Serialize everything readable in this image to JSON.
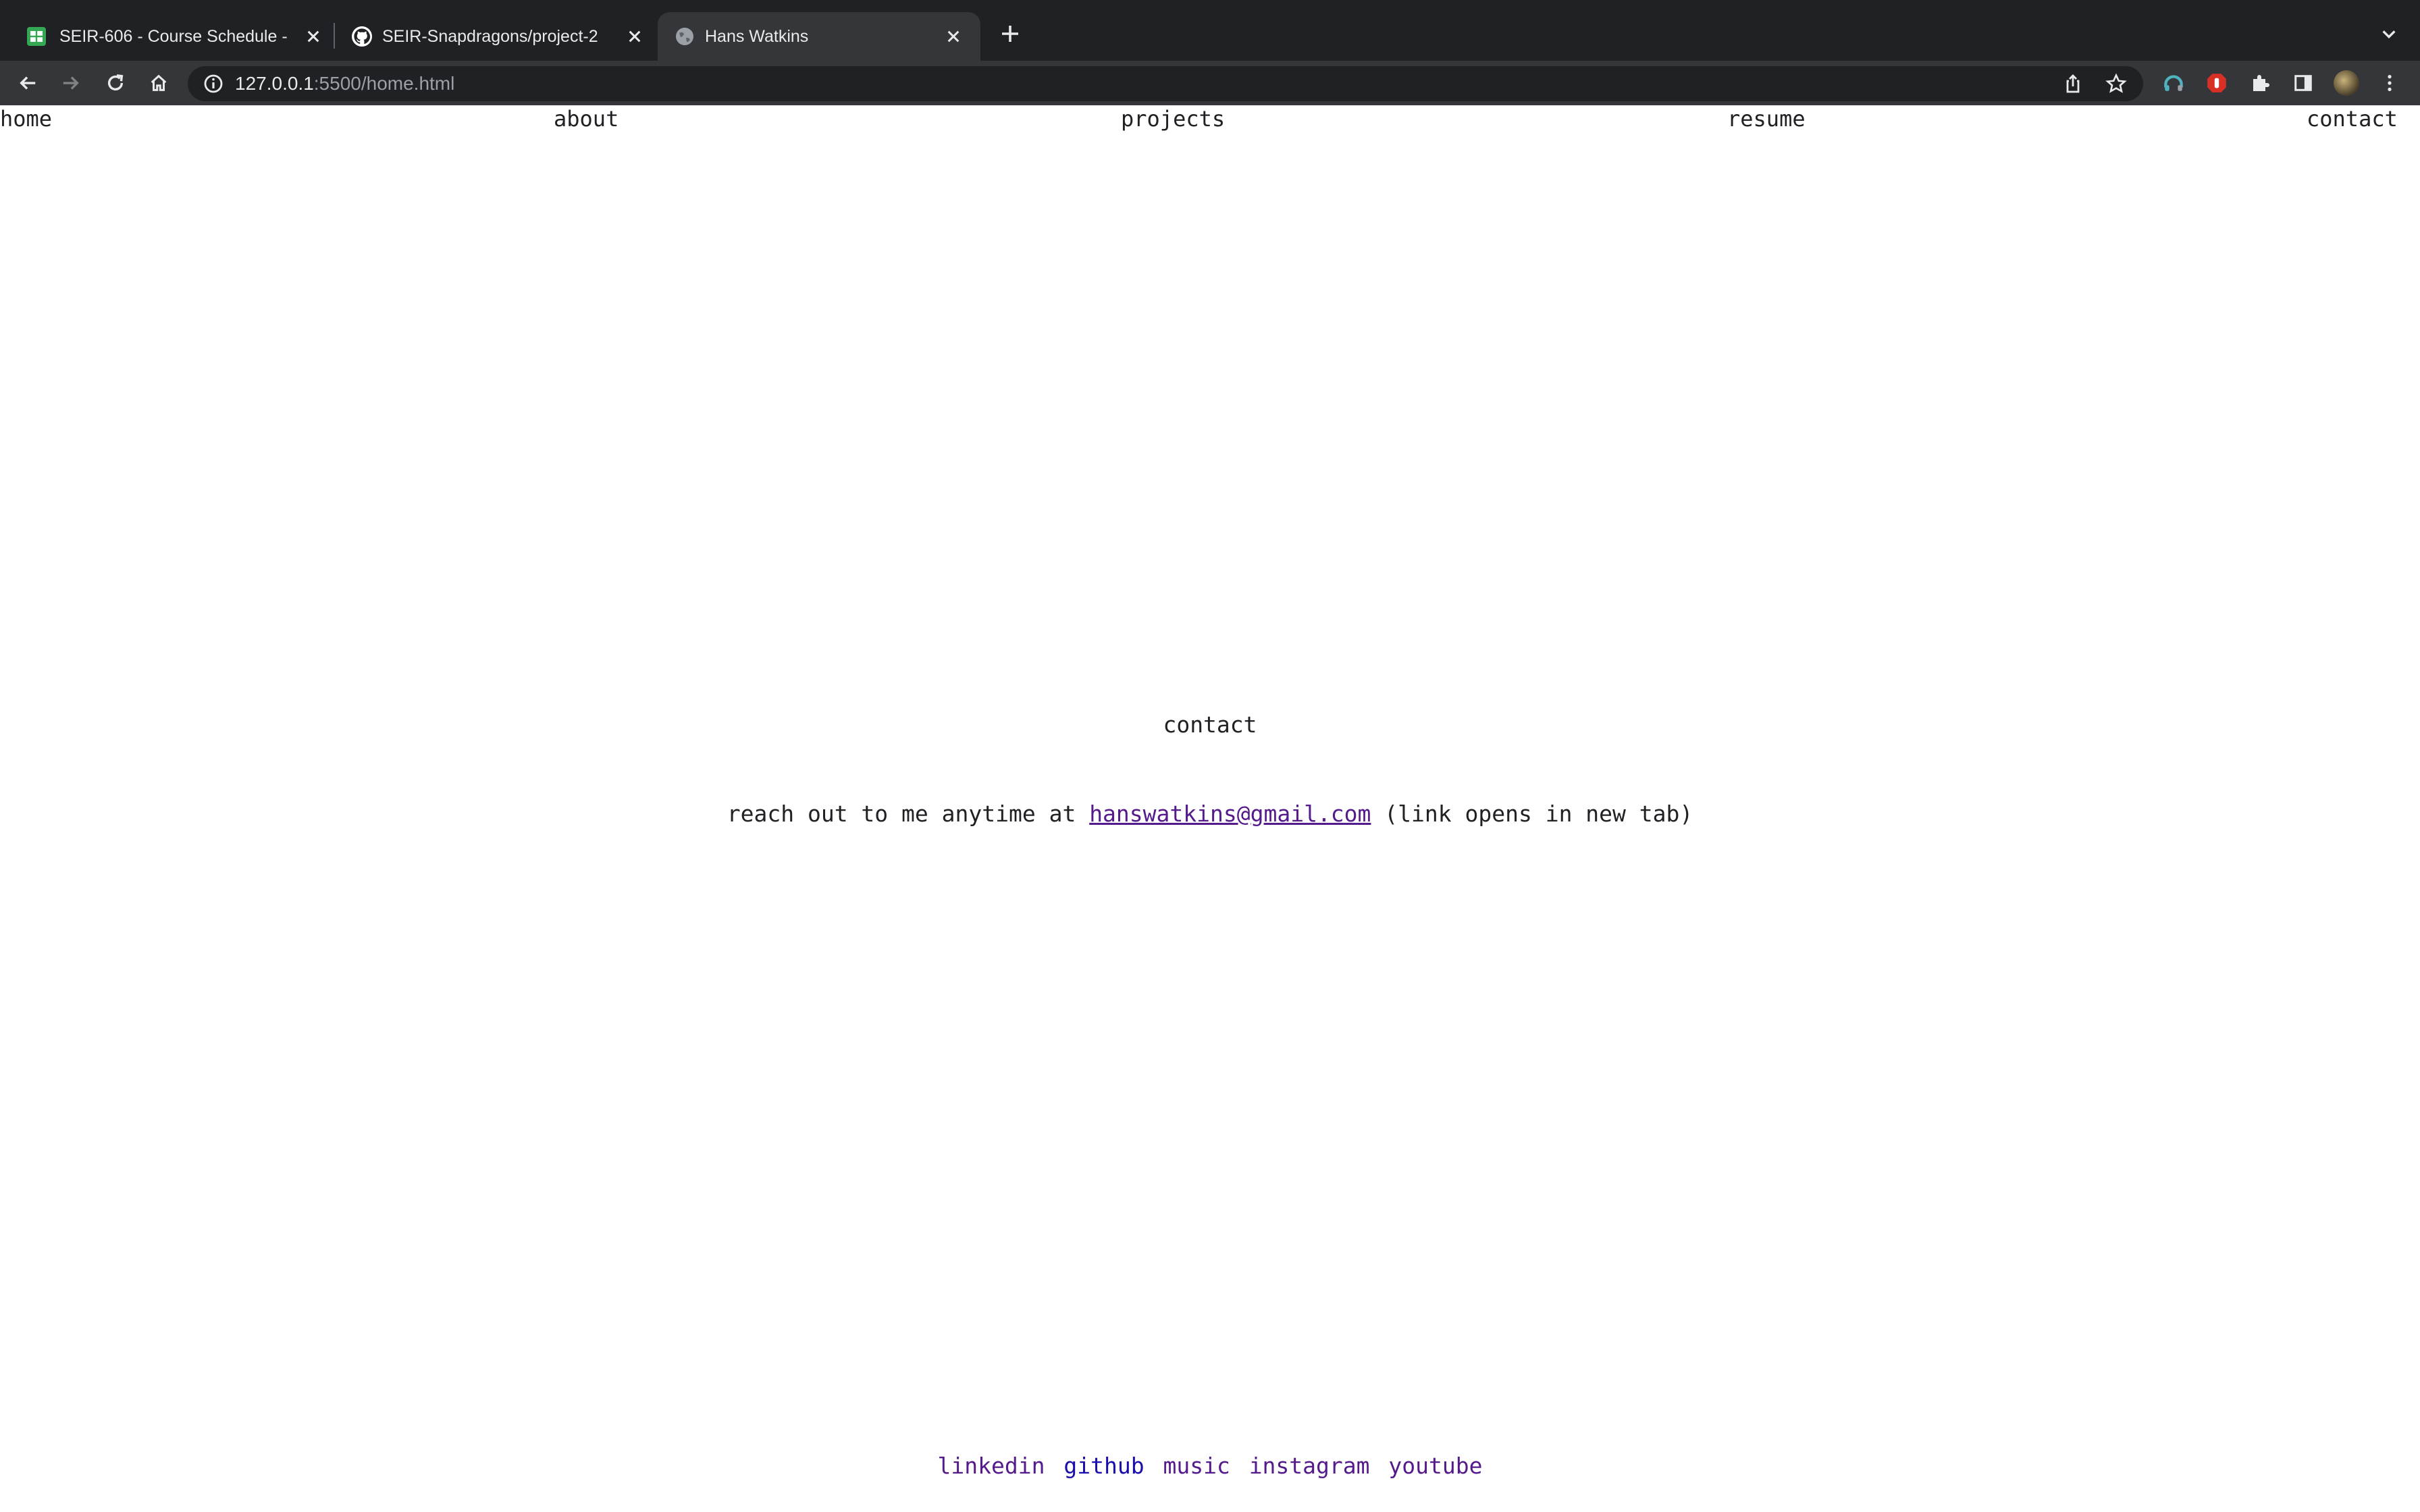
{
  "browser": {
    "tabs": [
      {
        "title": "SEIR-606 - Course Schedule -",
        "icon": "google-sheets-icon",
        "active": false
      },
      {
        "title": "SEIR-Snapdragons/project-2",
        "icon": "github-icon",
        "active": false
      },
      {
        "title": "Hans Watkins",
        "icon": "globe-icon",
        "active": true
      }
    ],
    "url_host": "127.0.0.1",
    "url_rest": ":5500/home.html"
  },
  "nav": {
    "home": "home",
    "about": "about",
    "projects": "projects",
    "resume": "resume",
    "contact": "contact"
  },
  "main": {
    "heading": "contact",
    "message_prefix": "reach out to me anytime at ",
    "email": "hanswatkins@gmail.com",
    "message_suffix": " (link opens in new tab)"
  },
  "footer": {
    "links": [
      "linkedin",
      "github",
      "music",
      "instagram",
      "youtube"
    ]
  },
  "colors": {
    "chrome_dark": "#202124",
    "chrome_toolbar": "#35363a",
    "visited_link": "#551a8b",
    "link": "#1a0dab"
  }
}
